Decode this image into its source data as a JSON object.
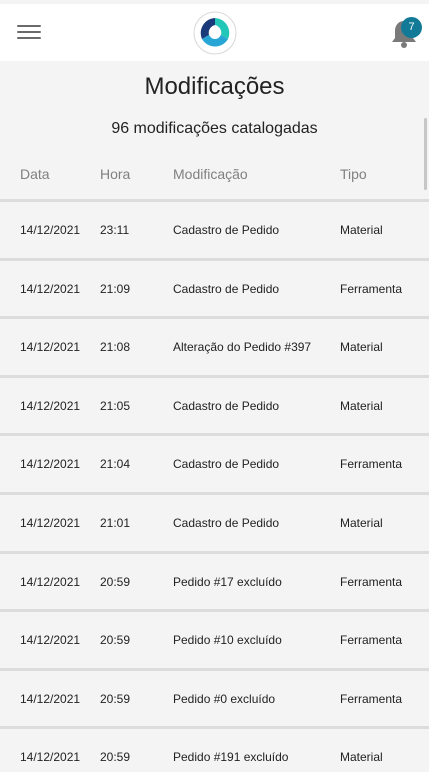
{
  "header": {
    "menu_icon": "hamburger-menu-icon",
    "logo_icon": "app-logo",
    "notification_icon": "bell-icon",
    "notification_count": "7",
    "colors": {
      "badge": "#127a96",
      "logo_dark": "#1b3a7a",
      "logo_light": "#22c7b8"
    }
  },
  "page": {
    "title": "Modificações",
    "subtitle": "96 modificações catalogadas"
  },
  "table": {
    "headers": {
      "date": "Data",
      "time": "Hora",
      "modification": "Modificação",
      "type": "Tipo"
    },
    "rows": [
      {
        "date": "14/12/2021",
        "time": "23:11",
        "modification": "Cadastro de Pedido",
        "type": "Material"
      },
      {
        "date": "14/12/2021",
        "time": "21:09",
        "modification": "Cadastro de Pedido",
        "type": "Ferramenta"
      },
      {
        "date": "14/12/2021",
        "time": "21:08",
        "modification": "Alteração do Pedido #397",
        "type": "Material"
      },
      {
        "date": "14/12/2021",
        "time": "21:05",
        "modification": "Cadastro de Pedido",
        "type": "Material"
      },
      {
        "date": "14/12/2021",
        "time": "21:04",
        "modification": "Cadastro de Pedido",
        "type": "Ferramenta"
      },
      {
        "date": "14/12/2021",
        "time": "21:01",
        "modification": "Cadastro de Pedido",
        "type": "Material"
      },
      {
        "date": "14/12/2021",
        "time": "20:59",
        "modification": "Pedido #17 excluído",
        "type": "Ferramenta"
      },
      {
        "date": "14/12/2021",
        "time": "20:59",
        "modification": "Pedido #10 excluído",
        "type": "Ferramenta"
      },
      {
        "date": "14/12/2021",
        "time": "20:59",
        "modification": "Pedido #0 excluído",
        "type": "Ferramenta"
      },
      {
        "date": "14/12/2021",
        "time": "20:59",
        "modification": "Pedido #191 excluído",
        "type": "Material"
      }
    ]
  }
}
